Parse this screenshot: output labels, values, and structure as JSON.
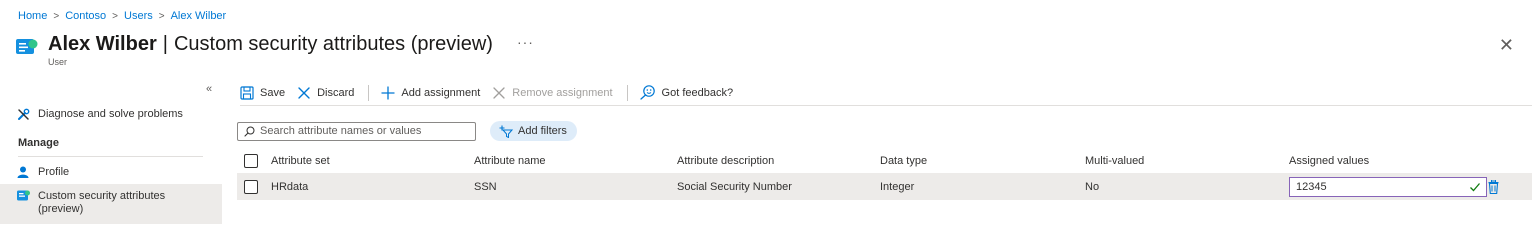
{
  "breadcrumb": {
    "items": [
      "Home",
      "Contoso",
      "Users",
      "Alex Wilber"
    ],
    "separator": ">"
  },
  "header": {
    "title_name": "Alex Wilber",
    "title_separator": "|",
    "title_page": "Custom security attributes (preview)",
    "more": "···",
    "subtitle": "User",
    "close": "✕"
  },
  "sidebar": {
    "collapse": "«",
    "diagnose_label": "Diagnose and solve problems",
    "manage_heading": "Manage",
    "profile_label": "Profile",
    "csa_label_line1": "Custom security attributes",
    "csa_label_line2": "(preview)"
  },
  "toolbar": {
    "save": "Save",
    "discard": "Discard",
    "add_assignment": "Add assignment",
    "remove_assignment": "Remove assignment",
    "feedback": "Got feedback?"
  },
  "filters": {
    "search_placeholder": "Search attribute names or values",
    "add_filters": "Add filters"
  },
  "table": {
    "columns": [
      "Attribute set",
      "Attribute name",
      "Attribute description",
      "Data type",
      "Multi-valued",
      "Assigned values"
    ],
    "rows": [
      {
        "set": "HRdata",
        "name": "SSN",
        "description": "Social Security Number",
        "data_type": "Integer",
        "multi_valued": "No",
        "assigned_value": "12345"
      }
    ]
  },
  "colors": {
    "link": "#0078d4",
    "accent_purple": "#8764b8",
    "success_green": "#107c10",
    "selected_bg": "#edebe9",
    "filter_pill": "#deecf9"
  },
  "icons": [
    "user-card-icon",
    "wrench-icon",
    "person-icon",
    "attributes-icon",
    "save-icon",
    "discard-icon",
    "add-icon",
    "remove-icon",
    "feedback-icon",
    "search-icon",
    "add-filter-icon",
    "checkmark-icon",
    "trash-icon"
  ]
}
